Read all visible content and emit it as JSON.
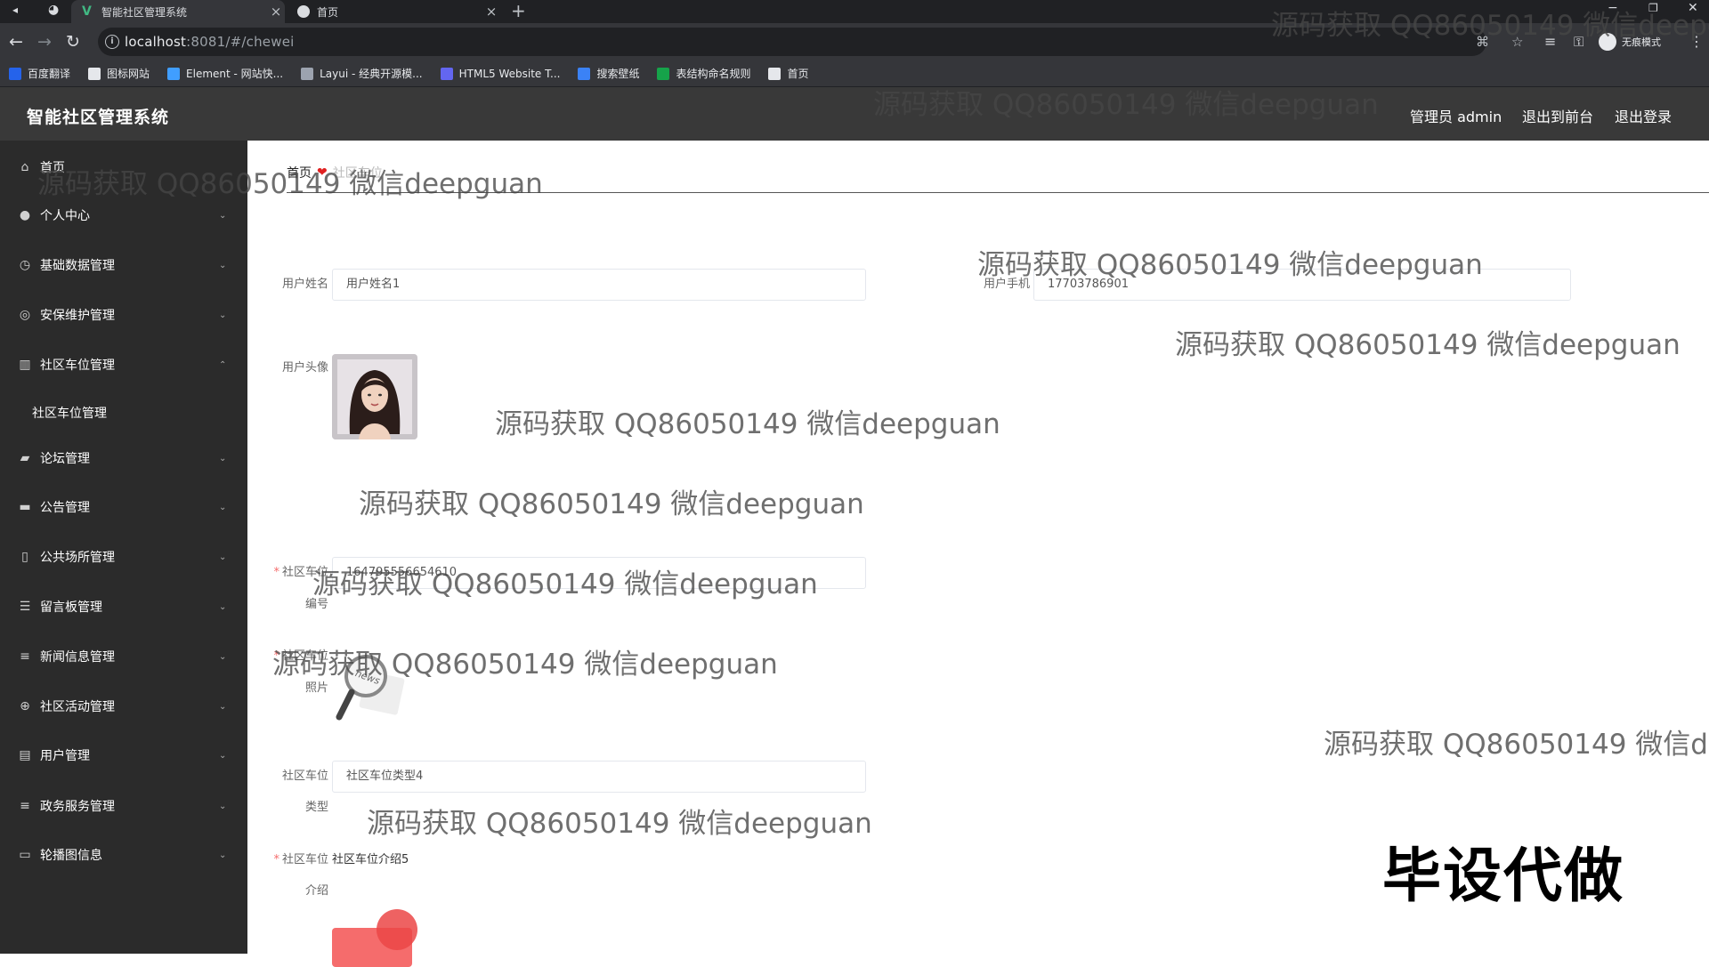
{
  "browser": {
    "tabs": [
      {
        "title": "智能社区管理系统",
        "active": true
      },
      {
        "title": "首页",
        "active": false
      }
    ],
    "address": {
      "host": "localhost",
      "rest": ":8081/#/chewei"
    },
    "incognito_label": "无痕模式",
    "bookmarks": [
      {
        "label": "百度翻译",
        "color": "#2563eb"
      },
      {
        "label": "图标网站",
        "color": "#e5e7eb"
      },
      {
        "label": "Element - 网站快...",
        "color": "#409eff"
      },
      {
        "label": "Layui - 经典开源模...",
        "color": "#9ca3af"
      },
      {
        "label": "HTML5 Website T...",
        "color": "#6366f1"
      },
      {
        "label": "搜索壁纸",
        "color": "#3b82f6"
      },
      {
        "label": "表结构命名规则",
        "color": "#16a34a"
      },
      {
        "label": "首页",
        "color": "#e5e7eb"
      }
    ]
  },
  "header": {
    "title": "智能社区管理系统",
    "admin": "管理员 admin",
    "to_front": "退出到前台",
    "logout": "退出登录"
  },
  "sidebar": {
    "items": [
      {
        "label": "首页",
        "icon": "home-icon",
        "glyph": "⌂"
      },
      {
        "label": "个人中心",
        "icon": "user-icon",
        "glyph": "●"
      },
      {
        "label": "基础数据管理",
        "icon": "clock-icon",
        "glyph": "◷"
      },
      {
        "label": "安保维护管理",
        "icon": "compass-icon",
        "glyph": "◎"
      },
      {
        "label": "社区车位管理",
        "icon": "chart-icon",
        "glyph": "▥"
      },
      {
        "label": "论坛管理",
        "icon": "like-icon",
        "glyph": "▰"
      },
      {
        "label": "公告管理",
        "icon": "message-icon",
        "glyph": "▬"
      },
      {
        "label": "公共场所管理",
        "icon": "mobile-icon",
        "glyph": "▯"
      },
      {
        "label": "留言板管理",
        "icon": "sliders-icon",
        "glyph": "☰"
      },
      {
        "label": "新闻信息管理",
        "icon": "list-icon",
        "glyph": "≡"
      },
      {
        "label": "社区活动管理",
        "icon": "globe-icon",
        "glyph": "⊕"
      },
      {
        "label": "用户管理",
        "icon": "user-table-icon",
        "glyph": "▤"
      },
      {
        "label": "政务服务管理",
        "icon": "menu-icon",
        "glyph": "≡"
      },
      {
        "label": "轮播图信息",
        "icon": "chat-icon",
        "glyph": "▭"
      }
    ],
    "submenu": {
      "label": "社区车位管理"
    }
  },
  "breadcrumb": {
    "home": "首页",
    "current": "社区车位"
  },
  "form": {
    "user_name": {
      "label": "用户姓名",
      "value": "用户姓名1"
    },
    "user_phone": {
      "label": "用户手机",
      "value": "17703786901"
    },
    "user_avatar": {
      "label": "用户头像"
    },
    "spot_code": {
      "label_1": "社区车位",
      "label_2": "编号",
      "value": "1647955566546​10"
    },
    "spot_photo": {
      "label_1": "社区车位",
      "label_2": "照片",
      "image_text": "news"
    },
    "spot_type": {
      "label_1": "社区车位",
      "label_2": "类型",
      "value": "社区车位类型4"
    },
    "spot_intro": {
      "label_1": "社区车位",
      "label_2": "介绍",
      "value": "社区车位介绍5"
    },
    "required_mark": "*"
  },
  "watermarks": {
    "text": "源码获取 QQ86050149 微信deepguan",
    "partial_top": "源码获取 QQ86050149 微信deepgu",
    "partial_right": "源码获取 QQ86050149 微信de",
    "brand": "毕设代做"
  }
}
